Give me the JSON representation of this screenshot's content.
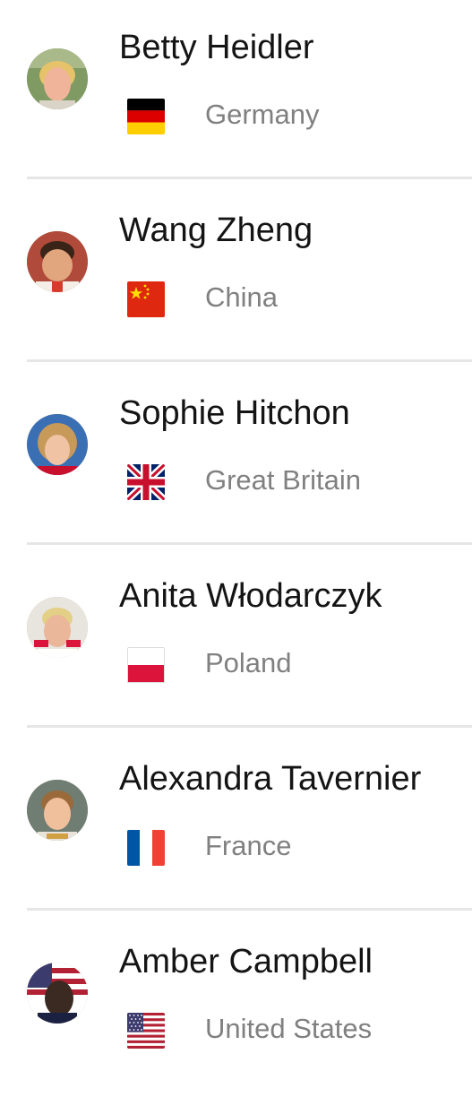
{
  "athletes": [
    {
      "name": "Betty Heidler",
      "country": "Germany",
      "flag_icon": "flag-germany-icon"
    },
    {
      "name": "Wang Zheng",
      "country": "China",
      "flag_icon": "flag-china-icon"
    },
    {
      "name": "Sophie Hitchon",
      "country": "Great Britain",
      "flag_icon": "flag-great-britain-icon"
    },
    {
      "name": "Anita Włodarczyk",
      "country": "Poland",
      "flag_icon": "flag-poland-icon"
    },
    {
      "name": "Alexandra Tavernier",
      "country": "France",
      "flag_icon": "flag-france-icon"
    },
    {
      "name": "Amber Campbell",
      "country": "United States",
      "flag_icon": "flag-united-states-icon"
    }
  ],
  "colors": {
    "name_text": "#141414",
    "country_text": "#808080",
    "divider": "#e6e6e6",
    "background": "#ffffff"
  }
}
